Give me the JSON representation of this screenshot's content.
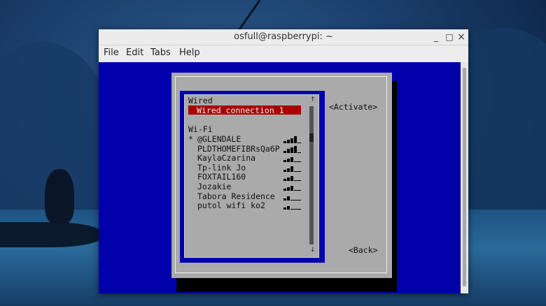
{
  "window": {
    "title": "osfull@raspberrypi: ~",
    "buttons": {
      "minimize": "_",
      "maximize": "□",
      "close": "×"
    }
  },
  "menubar": [
    "File",
    "Edit",
    "Tabs",
    "Help"
  ],
  "nmtui": {
    "wired_header": "Wired",
    "wired_connections": [
      "Wired connection 1"
    ],
    "wifi_header": "Wi-Fi",
    "wifi_networks": [
      {
        "marker": "*",
        "ssid": "@GLENDALE",
        "signal": 0.8
      },
      {
        "marker": "",
        "ssid": "PLDTHOMEFIBRsQa6P",
        "signal": 0.8
      },
      {
        "marker": "",
        "ssid": "KaylaCzarina",
        "signal": 0.6
      },
      {
        "marker": "",
        "ssid": "Tp-link Jo",
        "signal": 0.6
      },
      {
        "marker": "",
        "ssid": "FOXTAIL160",
        "signal": 0.6
      },
      {
        "marker": "",
        "ssid": "Jozakie",
        "signal": 0.6
      },
      {
        "marker": "",
        "ssid": "Tabora Residence",
        "signal": 0.4
      },
      {
        "marker": "",
        "ssid": "putol wifi ko2",
        "signal": 0.4
      }
    ],
    "activate_button": "<Activate>",
    "back_button": "<Back>",
    "scroll_up": "↑",
    "scroll_down": "↓"
  },
  "colors": {
    "terminal_bg": "#0000aa",
    "dialog_bg": "#aaaaaa",
    "selected_bg": "#aa0000"
  }
}
